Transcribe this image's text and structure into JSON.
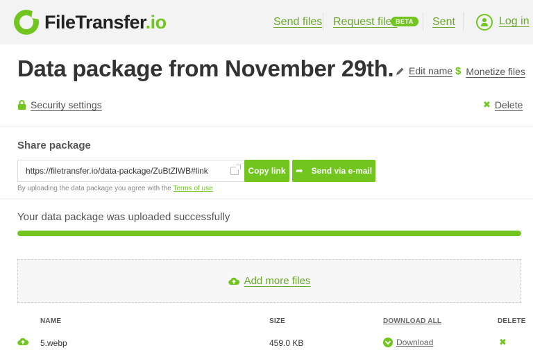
{
  "header": {
    "logo_text_main": "FileTransfer",
    "logo_text_accent": ".io",
    "nav": {
      "send_files": "Send files",
      "request_files": "Request files",
      "beta_badge": "BETA",
      "sent": "Sent",
      "log_in": "Log in"
    }
  },
  "package": {
    "title": "Data package from November 29th.",
    "edit_name": "Edit name",
    "monetize_files": "Monetize files",
    "security_settings": "Security settings",
    "delete": "Delete"
  },
  "share": {
    "heading": "Share package",
    "link_value": "https://filetransfer.io/data-package/ZuBtZlWB#link",
    "copy_link": "Copy link",
    "send_via_email": "Send via e-mail",
    "terms_prefix": "By uploading the data package you agree with the ",
    "terms_link": "Terms of use"
  },
  "upload": {
    "status_text": "Your data package was uploaded successfully",
    "progress_fraction": 1.0,
    "add_more_files": "Add more files"
  },
  "table": {
    "headers": {
      "name": "NAME",
      "size": "SIZE",
      "download_all": "DOWNLOAD ALL",
      "delete": "DELETE"
    },
    "rows": [
      {
        "name": "5.webp",
        "size": "459.0 KB",
        "download": "Download"
      }
    ]
  },
  "colors": {
    "accent": "#72c51f",
    "header_bg": "#f3f3f3"
  },
  "icons": {
    "logo": "filetransfer-logo-icon",
    "login": "user-circle-icon",
    "edit": "pencil-icon",
    "monetize": "dollar-icon",
    "security": "lock-icon",
    "delete": "close-x-icon",
    "external_link": "external-link-icon",
    "share": "share-arrow-icon",
    "upload": "cloud-upload-icon",
    "download": "download-circle-icon"
  }
}
